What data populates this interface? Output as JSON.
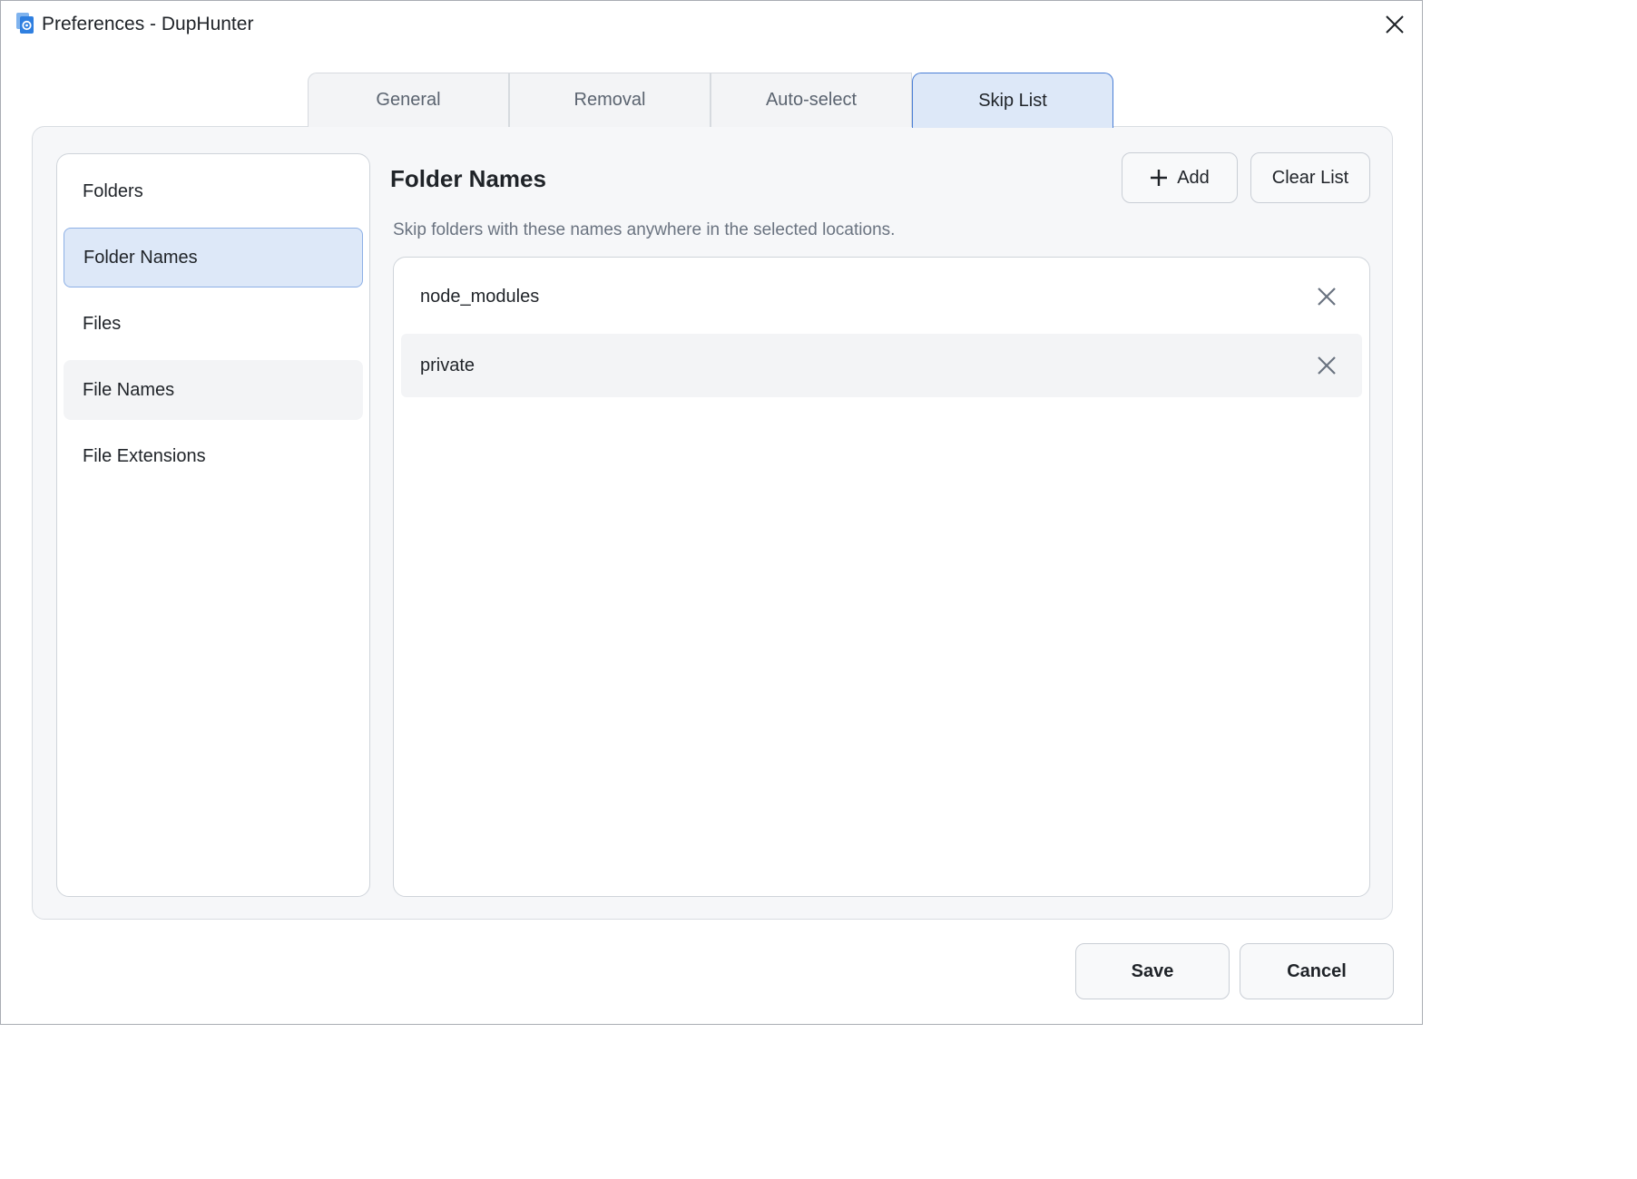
{
  "window": {
    "title": "Preferences - DupHunter",
    "app_icon": "duphunter-app-icon",
    "close_icon": "close-icon"
  },
  "tabs": [
    {
      "label": "General",
      "active": false
    },
    {
      "label": "Removal",
      "active": false
    },
    {
      "label": "Auto-select",
      "active": false
    },
    {
      "label": "Skip List",
      "active": true
    }
  ],
  "sidebar": {
    "items": [
      {
        "label": "Folders",
        "state": "normal"
      },
      {
        "label": "Folder Names",
        "state": "active"
      },
      {
        "label": "Files",
        "state": "normal"
      },
      {
        "label": "File Names",
        "state": "hover"
      },
      {
        "label": "File Extensions",
        "state": "normal"
      }
    ]
  },
  "content": {
    "title": "Folder Names",
    "add_label": "Add",
    "add_icon": "plus-icon",
    "clear_label": "Clear List",
    "description": "Skip folders with these names anywhere in the selected locations.",
    "entries": [
      {
        "name": "node_modules",
        "remove_icon": "remove-x-icon"
      },
      {
        "name": "private",
        "remove_icon": "remove-x-icon"
      }
    ]
  },
  "footer": {
    "save_label": "Save",
    "cancel_label": "Cancel"
  },
  "colors": {
    "accent": "#4a7fd6",
    "selected_bg": "#dde8f8",
    "panel_bg": "#f6f7f9",
    "border": "#cfd4da"
  }
}
